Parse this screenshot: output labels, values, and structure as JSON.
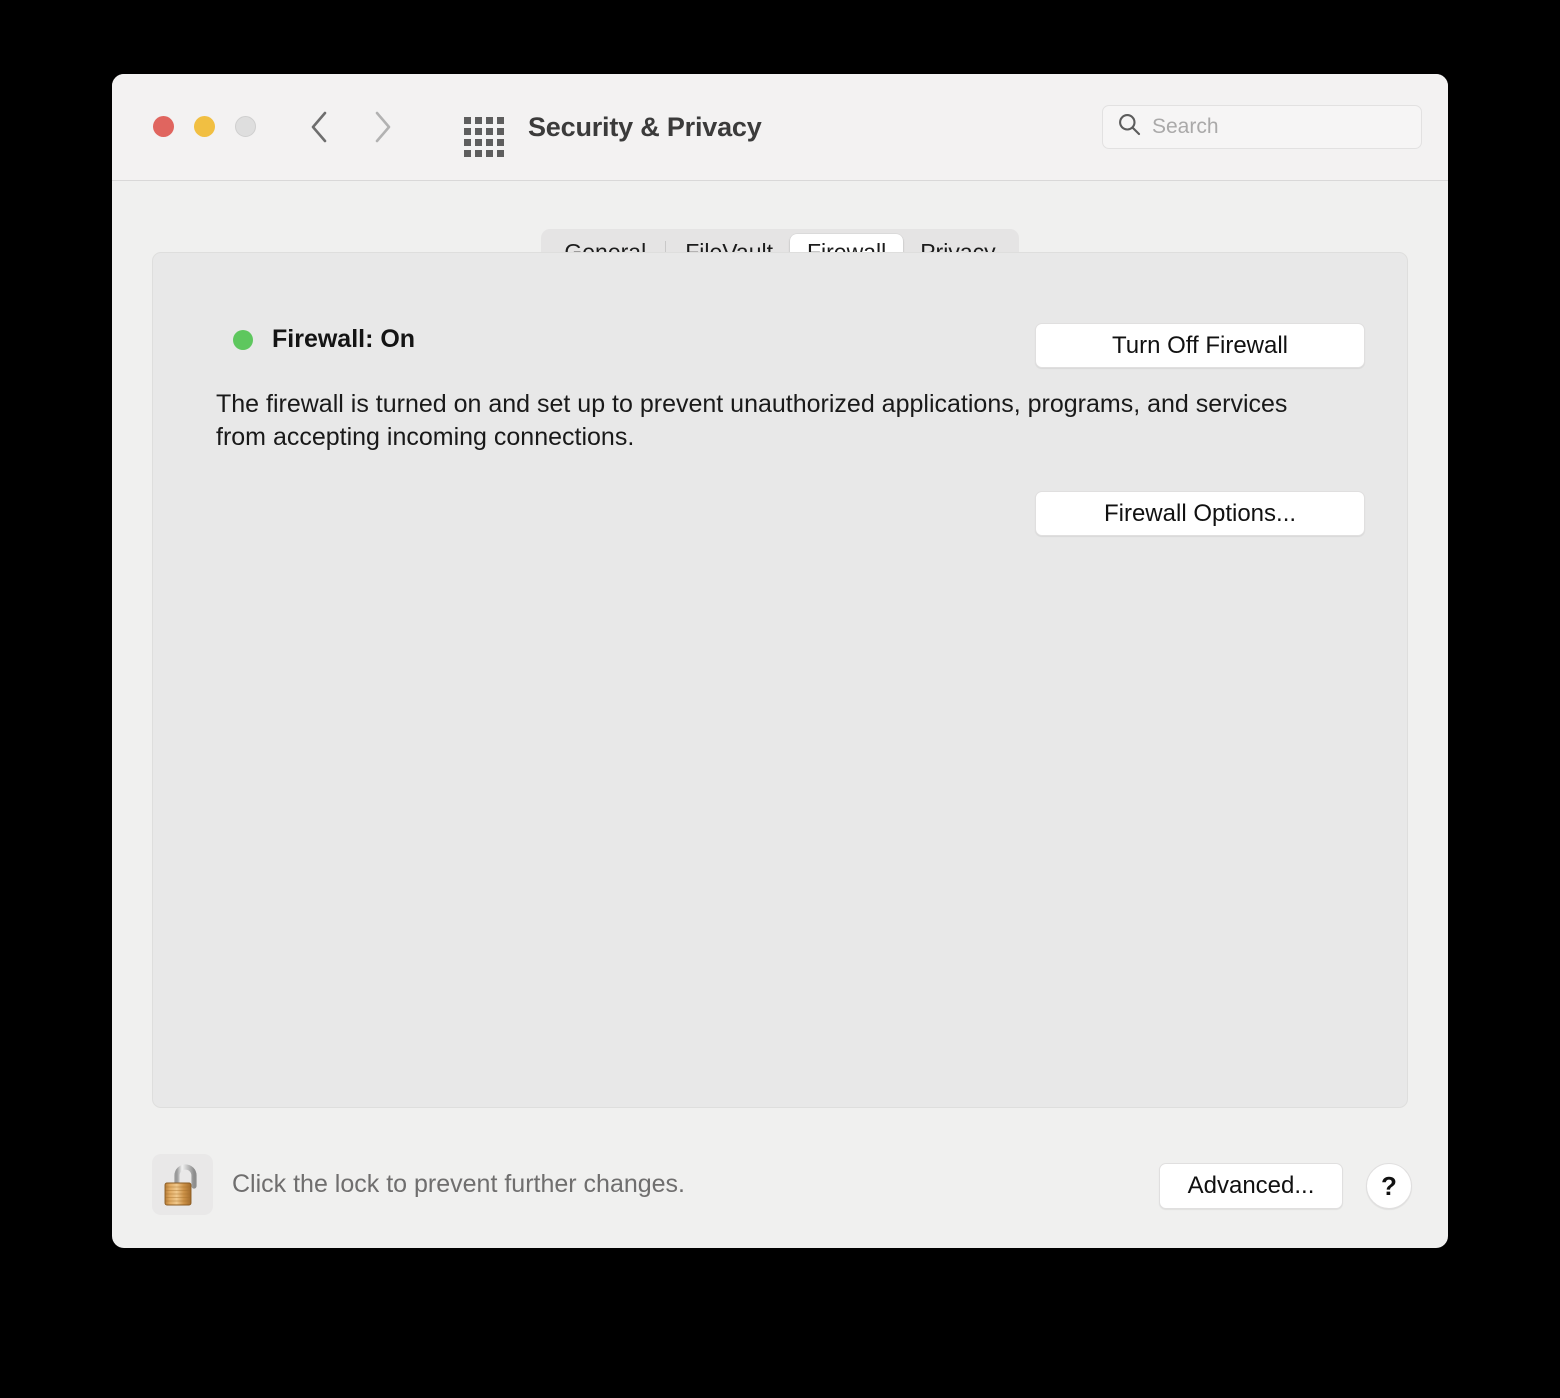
{
  "window": {
    "title": "Security & Privacy",
    "traffic_lights": {
      "close": "close-button",
      "minimize": "minimize-button",
      "zoom": "zoom-button"
    },
    "nav": {
      "back": "back-arrow",
      "forward": "forward-arrow"
    },
    "grid_button": "show-all-preferences"
  },
  "search": {
    "placeholder": "Search",
    "value": ""
  },
  "tabs": [
    {
      "label": "General",
      "selected": false
    },
    {
      "label": "FileVault",
      "selected": false
    },
    {
      "label": "Firewall",
      "selected": true
    },
    {
      "label": "Privacy",
      "selected": false
    }
  ],
  "firewall": {
    "status_label": "Firewall: On",
    "status_color": "#5ec75e",
    "turn_off_label": "Turn Off Firewall",
    "description": "The firewall is turned on and set up to prevent unauthorized applications, programs, and services from accepting incoming connections.",
    "options_label": "Firewall Options..."
  },
  "footer": {
    "lock_icon": "unlocked-padlock-icon",
    "lock_message": "Click the lock to prevent further changes.",
    "advanced_label": "Advanced...",
    "help_label": "?"
  },
  "colors": {
    "accent_green": "#5ec75e",
    "close_red": "#e0655f",
    "minimize_yellow": "#f1bf42",
    "zoom_gray": "#dedede",
    "window_bg": "#f0f0ef",
    "panel_bg": "#e8e8e8"
  }
}
